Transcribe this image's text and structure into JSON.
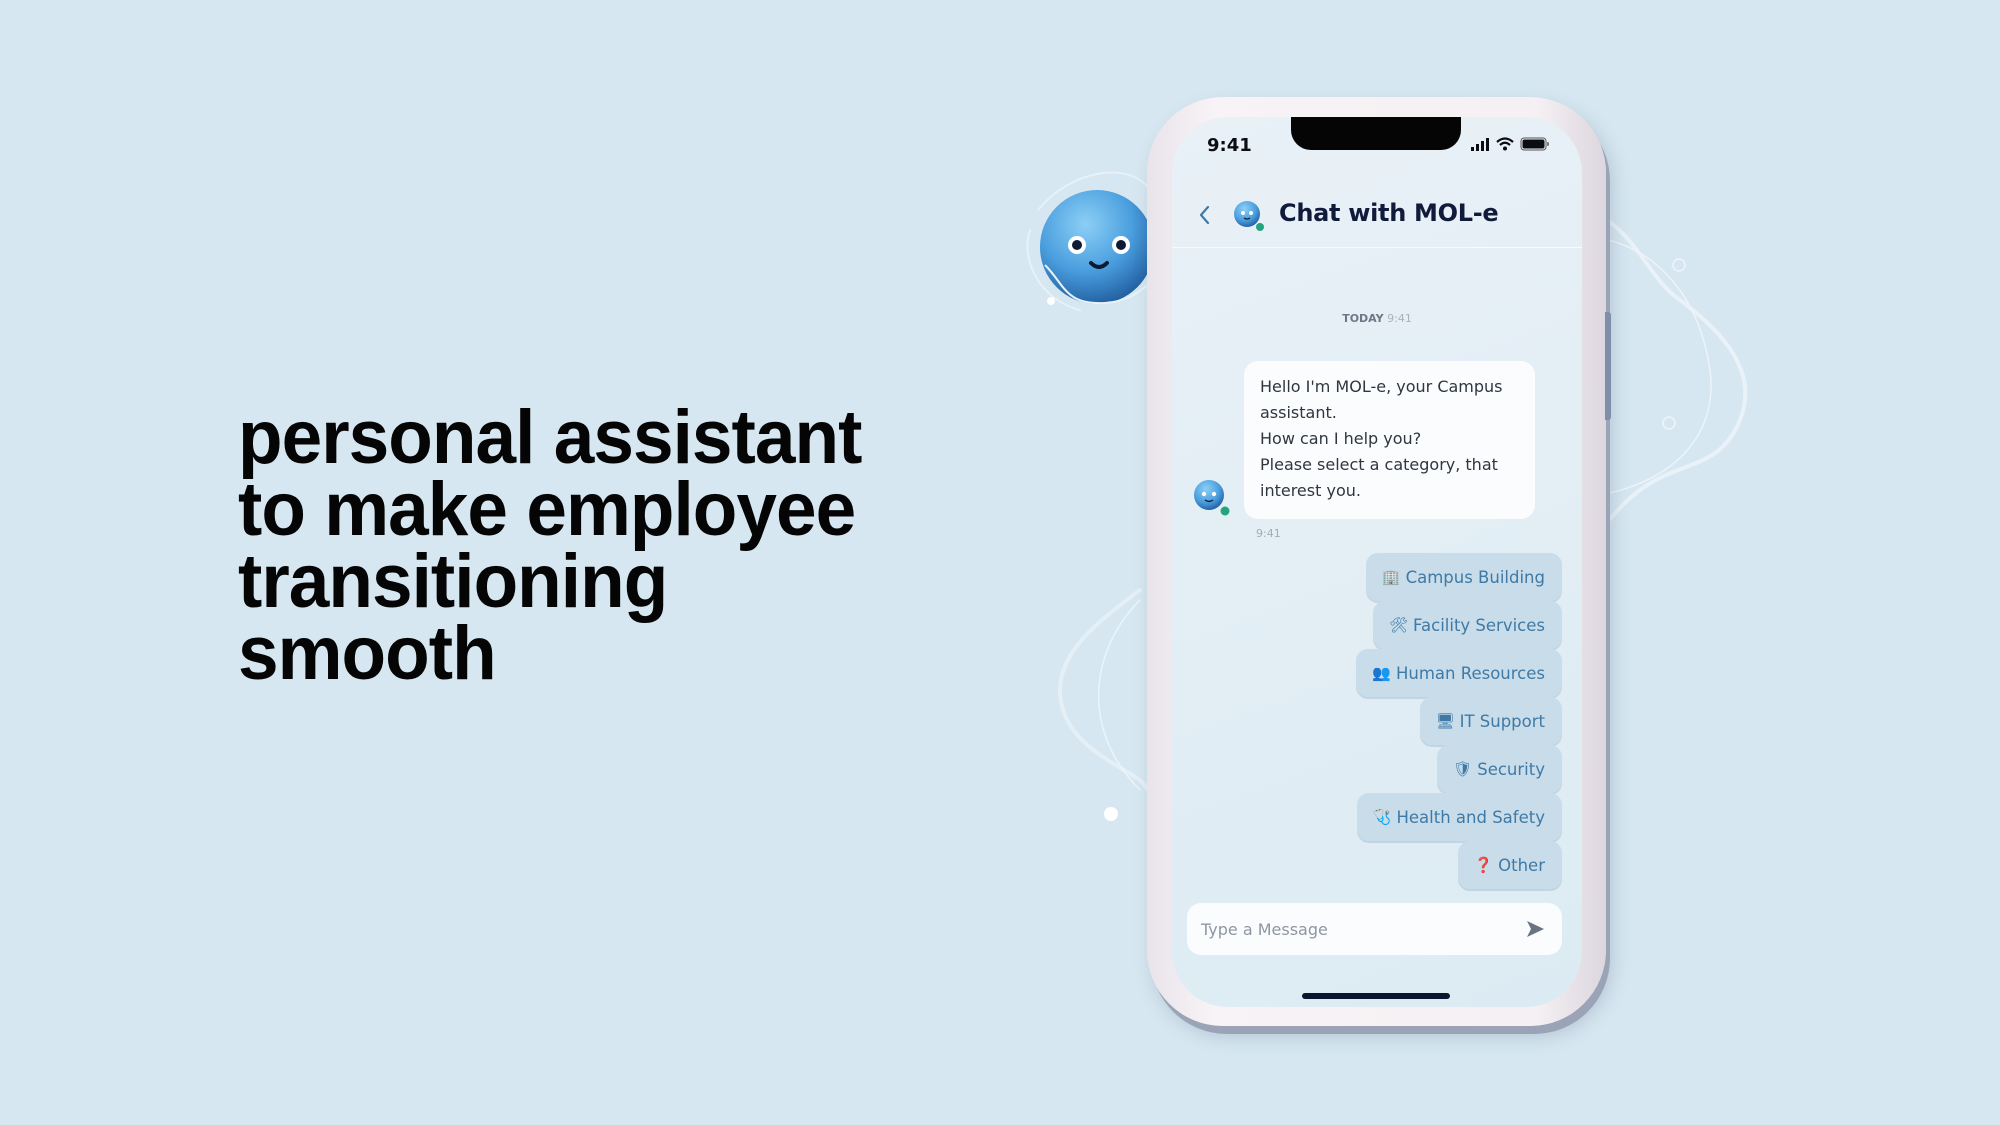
{
  "headline": {
    "lines": [
      "personal assistant",
      "to make employee",
      "transitioning",
      "smooth"
    ]
  },
  "status_bar": {
    "time": "9:41",
    "icons": [
      "signal-icon",
      "wifi-icon",
      "battery-icon"
    ]
  },
  "chat_header": {
    "back_icon": "chevron-left-icon",
    "title": "Chat with MOL-e",
    "online": true
  },
  "chat": {
    "day_label": "TODAY",
    "day_time": "9:41",
    "bot_message": {
      "lines": [
        "Hello I'm MOL-e, your Campus",
        "assistant.",
        "How can I help you?",
        "Please select a category, that",
        "interest you."
      ],
      "time": "9:41"
    },
    "options": [
      {
        "icon": "🏢",
        "label": "Campus Building"
      },
      {
        "icon": "🛠",
        "label": "Facility Services"
      },
      {
        "icon": "👥",
        "label": "Human Resources"
      },
      {
        "icon": "🖥",
        "label": "IT Support"
      },
      {
        "icon": "🛡",
        "label": "Security"
      },
      {
        "icon": "🩺",
        "label": "Health and Safety"
      },
      {
        "icon": "❓",
        "label": "Other"
      }
    ]
  },
  "composer": {
    "placeholder": "Type a Message",
    "value": "",
    "send_icon": "send-icon"
  },
  "colors": {
    "background": "#d6e7f1",
    "option_bg": "#c8dce9",
    "option_text": "#3f7aa6",
    "title_text": "#101a3a",
    "online_dot": "#22a47e",
    "mascot_blue": "#4da3e0"
  }
}
